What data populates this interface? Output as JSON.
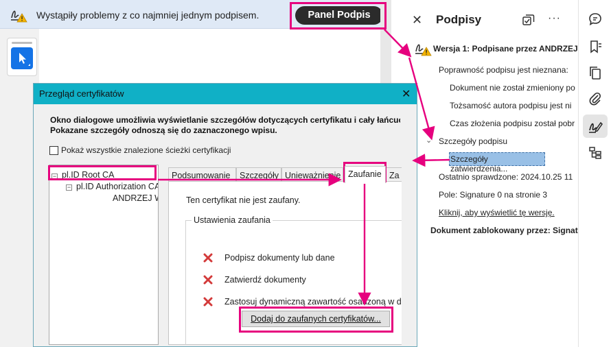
{
  "banner": {
    "message": "Wystąpiły problemy z co najmniej jednym podpisem.",
    "panel_button": "Panel Podpis"
  },
  "sig_panel": {
    "close_glyph": "✕",
    "title": "Podpisy",
    "more_glyph": "···",
    "version_title": "Wersja 1: Podpisane przez ANDRZEJ",
    "validity": "Poprawność podpisu jest nieznana:",
    "not_modified": "Dokument nie został zmieniony po",
    "identity": "Tożsamość autora podpisu jest ni",
    "signing_time": "Czas złożenia podpisu został pobr",
    "details_header": "Szczegóły podpisu",
    "details_item": "Szczegóły zatwierdzenia...",
    "last_checked": "Ostatnio sprawdzone: 2024.10.25 11",
    "field": "Pole: Signature 0 na stronie 3",
    "view_version_link": "Kliknij, aby wyświetlić tę wersję.",
    "locked_by": "Dokument zablokowany przez: Signat"
  },
  "dialog": {
    "title": "Przegląd certyfikatów",
    "close_glyph": "✕",
    "description_line1": "Okno dialogowe umożliwia wyświetlanie szczegółów dotyczących certyfikatu i cały łańcuc",
    "description_line2": "Pokazane szczegóły odnoszą się do zaznaczonego wpisu.",
    "show_all_paths": "Pokaż wszystkie znalezione ścieżki certyfikacji",
    "tree": {
      "root": "pl.ID Root CA",
      "child": "pl.ID Authorization CA",
      "leaf": "ANDRZEJ W"
    },
    "tabs": [
      "Podsumowanie",
      "Szczegóły",
      "Unieważnienie",
      "Zaufanie",
      "Za"
    ],
    "trust_status": "Ten certyfikat nie jest zaufany.",
    "trust_settings_label": "Ustawienia zaufania",
    "permissions": [
      "Podpisz dokumenty lub dane",
      "Zatwierdź dokumenty",
      "Zastosuj dynamiczną zawartość osadzoną w do"
    ],
    "add_trusted_button": "Dodaj do zaufanych certyfikatów..."
  },
  "colors": {
    "accent_blue": "#1473e6",
    "dialog_titlebar": "#10b0c6",
    "annotation_magenta": "#e6007e",
    "warning_yellow": "#f5b400",
    "deny_red": "#d33a3a"
  },
  "icons": [
    "signature-warning-icon",
    "select-arrow-icon",
    "manage-tools-icon",
    "comment-icon",
    "bookmark-icon",
    "pages-icon",
    "attachment-icon",
    "signature-icon",
    "structure-icon",
    "deny-x-icon"
  ]
}
